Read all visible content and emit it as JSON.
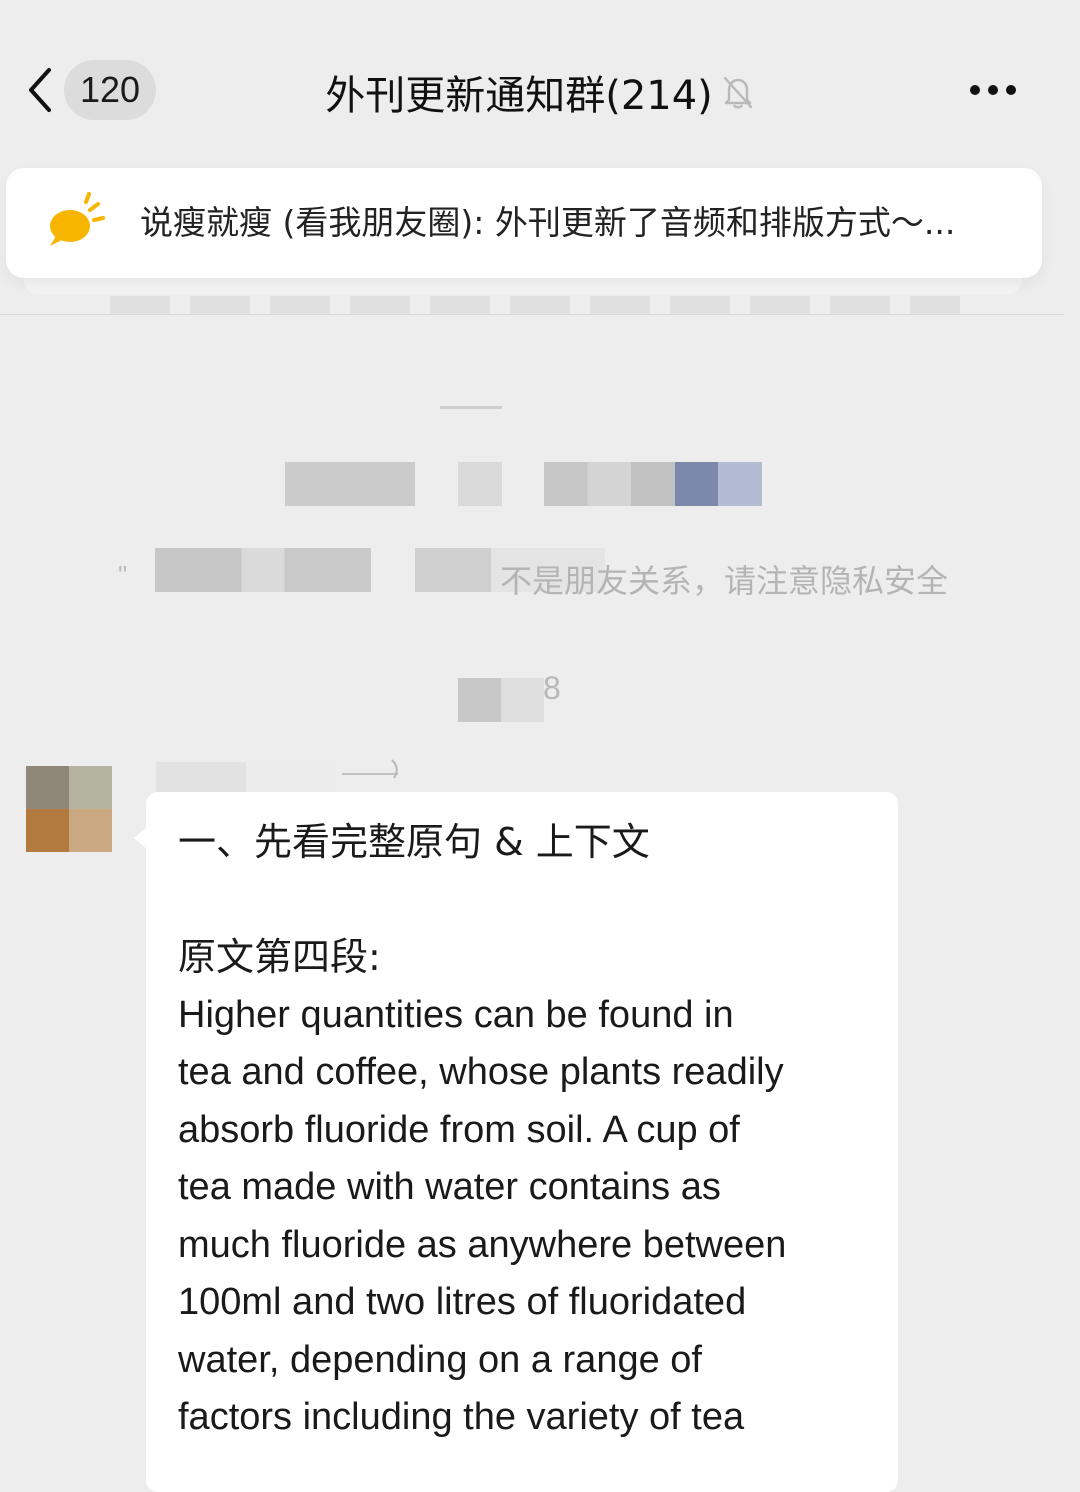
{
  "header": {
    "unread_count": "120",
    "title": "外刊更新通知群(214)"
  },
  "pinned_notice": {
    "text": "说瘦就瘦 (看我朋友圈): 外刊更新了音频和排版方式～..."
  },
  "system_notice": {
    "visible_fragment": "不是朋友关系，请注意隐私安全",
    "quote_mark": "\"",
    "time_fragment": "8"
  },
  "message": {
    "heading": "一、先看完整原句 & 上下文",
    "section_label": "原文第四段:",
    "lines": [
      "Higher quantities can be found in",
      "tea and coffee, whose plants readily",
      "absorb fluoride from soil. A cup of",
      "tea made with water contains as",
      "much fluoride as anywhere between",
      "100ml and two litres of fluoridated",
      "water, depending on a range of",
      "factors including the variety of tea"
    ]
  },
  "colors": {
    "background": "#ededed",
    "bubble": "#ffffff",
    "accent_icon": "#f7b500"
  },
  "icons": {
    "back": "chevron-left-icon",
    "mute": "bell-off-icon",
    "more": "more-dots-icon",
    "pinned": "announcement-bubble-icon"
  }
}
